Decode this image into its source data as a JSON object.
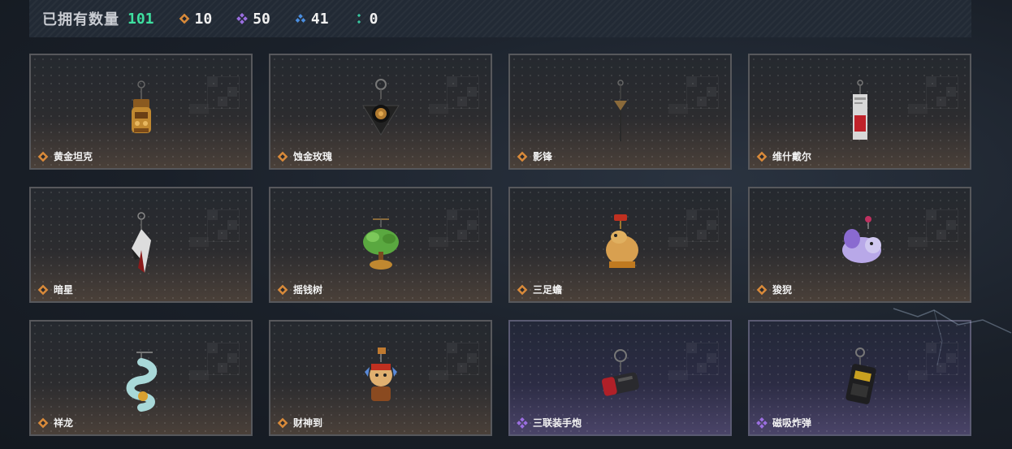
{
  "header": {
    "owned_label": "已拥有数量",
    "owned_value": "101",
    "stats": [
      {
        "icon": "orange-diamond-icon",
        "color": "#d98a3a",
        "count": "10"
      },
      {
        "icon": "purple-diamond-icon",
        "color": "#9b6ee0",
        "count": "50"
      },
      {
        "icon": "blue-diamond-icon",
        "color": "#4a8ee0",
        "count": "41"
      },
      {
        "icon": "green-diamond-icon",
        "color": "#38c9a0",
        "count": "0"
      }
    ]
  },
  "colors": {
    "accent_green": "#3ee0a0",
    "rarity_orange": "#d98a3a",
    "rarity_purple": "#9b6ee0"
  },
  "items": [
    {
      "name": "黄金坦克",
      "rarity": "orange",
      "icon": "golden-tank-charm"
    },
    {
      "name": "蚀金玫瑰",
      "rarity": "orange",
      "icon": "rose-charm"
    },
    {
      "name": "影锋",
      "rarity": "orange",
      "icon": "shadow-blade-charm"
    },
    {
      "name": "维什戴尔",
      "rarity": "orange",
      "icon": "card-charm"
    },
    {
      "name": "暗星",
      "rarity": "orange",
      "icon": "dark-star-charm"
    },
    {
      "name": "摇钱树",
      "rarity": "orange",
      "icon": "money-tree-charm"
    },
    {
      "name": "三足蟾",
      "rarity": "orange",
      "icon": "toad-charm"
    },
    {
      "name": "狻猊",
      "rarity": "orange",
      "icon": "lion-charm"
    },
    {
      "name": "祥龙",
      "rarity": "orange",
      "icon": "dragon-charm"
    },
    {
      "name": "财神到",
      "rarity": "orange",
      "icon": "fortune-god-charm"
    },
    {
      "name": "三联装手炮",
      "rarity": "purple",
      "icon": "hand-cannon-charm"
    },
    {
      "name": "磁吸炸弹",
      "rarity": "purple",
      "icon": "magnetic-bomb-charm"
    }
  ]
}
